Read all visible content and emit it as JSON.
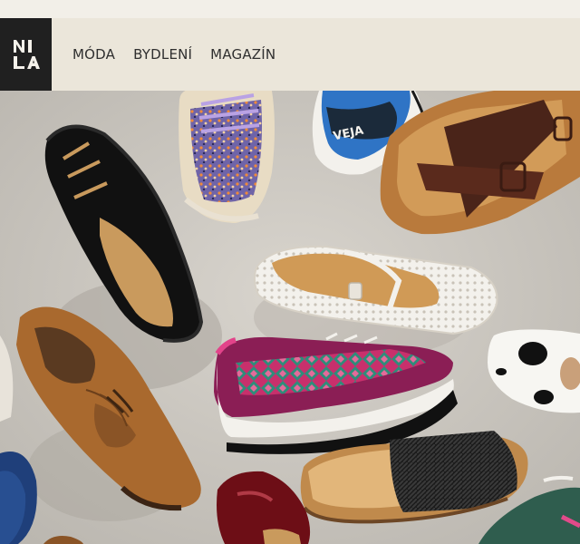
{
  "brand": {
    "logo_text": "NILA"
  },
  "nav": {
    "items": [
      {
        "label": "MÓDA"
      },
      {
        "label": "BYDLENÍ"
      },
      {
        "label": "MAGAZÍN"
      }
    ]
  },
  "hero": {
    "sneaker_brand_text": "VEJA",
    "colors": {
      "background": "#cfcbc4",
      "header_bg": "#ebe6da",
      "logo_bg": "#202020"
    },
    "icons": [
      "logo-mark"
    ]
  }
}
